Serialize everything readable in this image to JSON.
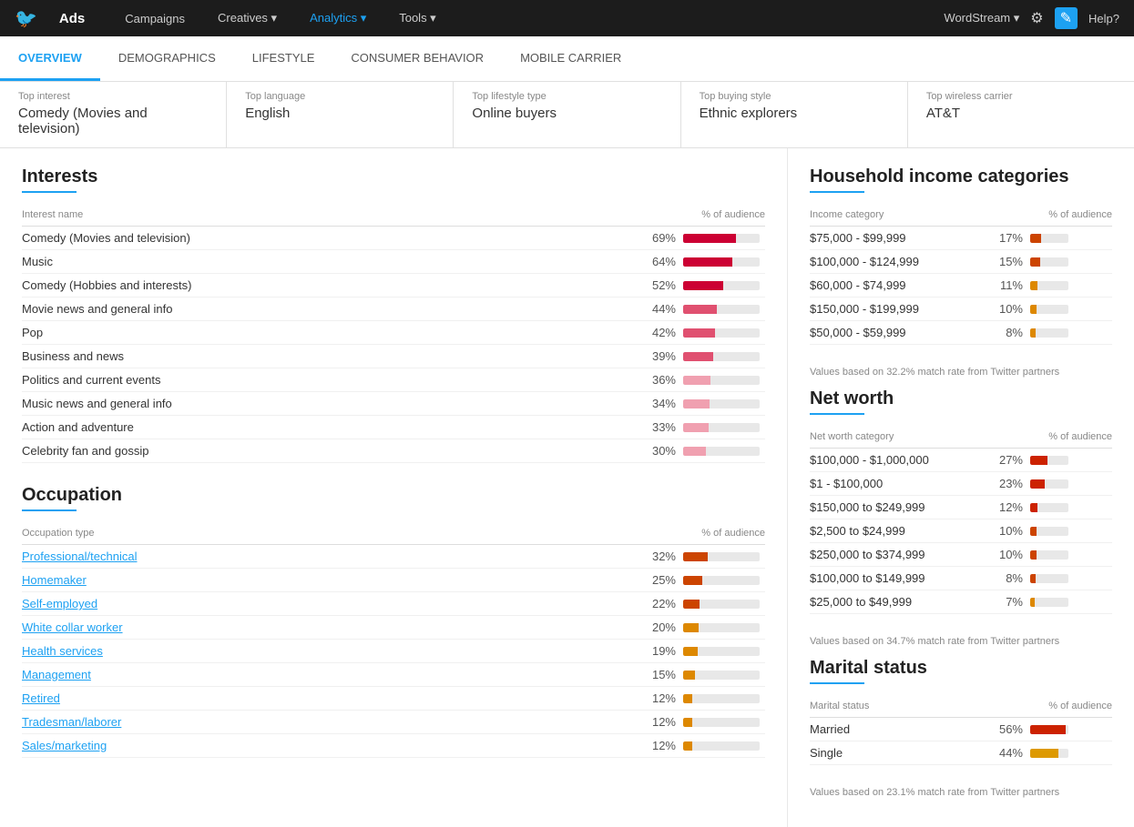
{
  "topnav": {
    "brand": "Ads",
    "items": [
      "Campaigns",
      "Creatives ▾",
      "Analytics ▾",
      "Tools ▾"
    ],
    "active_item": "Analytics ▾",
    "right_items": [
      "WordStream ▾",
      "⚙",
      "✎",
      "Help?"
    ]
  },
  "overview_tabs": [
    "OVERVIEW",
    "DEMOGRAPHICS",
    "LIFESTYLE",
    "CONSUMER BEHAVIOR",
    "MOBILE CARRIER"
  ],
  "active_tab": 0,
  "summary_cards": [
    {
      "label": "Top interest",
      "value": "Comedy (Movies and television)"
    },
    {
      "label": "Top language",
      "value": "English"
    },
    {
      "label": "Top lifestyle type",
      "value": "Online buyers"
    },
    {
      "label": "Top buying style",
      "value": "Ethnic explorers"
    },
    {
      "label": "Top wireless carrier",
      "value": "AT&T"
    }
  ],
  "interests": {
    "title": "Interests",
    "col1": "Interest name",
    "col2": "% of audience",
    "rows": [
      {
        "name": "Comedy (Movies and television)",
        "pct": "69%",
        "val": 69,
        "color": "#cc0033"
      },
      {
        "name": "Music",
        "pct": "64%",
        "val": 64,
        "color": "#cc0033"
      },
      {
        "name": "Comedy (Hobbies and interests)",
        "pct": "52%",
        "val": 52,
        "color": "#cc0033"
      },
      {
        "name": "Movie news and general info",
        "pct": "44%",
        "val": 44,
        "color": "#e05070"
      },
      {
        "name": "Pop",
        "pct": "42%",
        "val": 42,
        "color": "#e05070"
      },
      {
        "name": "Business and news",
        "pct": "39%",
        "val": 39,
        "color": "#e05070"
      },
      {
        "name": "Politics and current events",
        "pct": "36%",
        "val": 36,
        "color": "#f0a0b0"
      },
      {
        "name": "Music news and general info",
        "pct": "34%",
        "val": 34,
        "color": "#f0a0b0"
      },
      {
        "name": "Action and adventure",
        "pct": "33%",
        "val": 33,
        "color": "#f0a0b0"
      },
      {
        "name": "Celebrity fan and gossip",
        "pct": "30%",
        "val": 30,
        "color": "#f0a0b0"
      }
    ]
  },
  "occupation": {
    "title": "Occupation",
    "col1": "Occupation type",
    "col2": "% of audience",
    "rows": [
      {
        "name": "Professional/technical",
        "pct": "32%",
        "val": 32,
        "color": "#cc4400",
        "link": true
      },
      {
        "name": "Homemaker",
        "pct": "25%",
        "val": 25,
        "color": "#cc4400",
        "link": true
      },
      {
        "name": "Self-employed",
        "pct": "22%",
        "val": 22,
        "color": "#cc4400",
        "link": true
      },
      {
        "name": "White collar worker",
        "pct": "20%",
        "val": 20,
        "color": "#dd8800",
        "link": true
      },
      {
        "name": "Health services",
        "pct": "19%",
        "val": 19,
        "color": "#dd8800",
        "link": true
      },
      {
        "name": "Management",
        "pct": "15%",
        "val": 15,
        "color": "#dd8800",
        "link": true
      },
      {
        "name": "Retired",
        "pct": "12%",
        "val": 12,
        "color": "#dd8800",
        "link": true
      },
      {
        "name": "Tradesman/laborer",
        "pct": "12%",
        "val": 12,
        "color": "#dd8800",
        "link": true
      },
      {
        "name": "Sales/marketing",
        "pct": "12%",
        "val": 12,
        "color": "#dd8800",
        "link": true
      }
    ]
  },
  "household_income": {
    "title": "Household income categories",
    "col1": "Income category",
    "col2": "% of audience",
    "note": "Values based on 32.2% match rate from Twitter partners",
    "rows": [
      {
        "name": "$75,000 - $99,999",
        "pct": "17%",
        "val": 17,
        "color": "#cc4400"
      },
      {
        "name": "$100,000 - $124,999",
        "pct": "15%",
        "val": 15,
        "color": "#cc4400"
      },
      {
        "name": "$60,000 - $74,999",
        "pct": "11%",
        "val": 11,
        "color": "#dd8800"
      },
      {
        "name": "$150,000 - $199,999",
        "pct": "10%",
        "val": 10,
        "color": "#dd8800"
      },
      {
        "name": "$50,000 - $59,999",
        "pct": "8%",
        "val": 8,
        "color": "#dd8800"
      }
    ]
  },
  "net_worth": {
    "title": "Net worth",
    "col1": "Net worth category",
    "col2": "% of audience",
    "note": "Values based on 34.7% match rate from Twitter partners",
    "rows": [
      {
        "name": "$100,000 - $1,000,000",
        "pct": "27%",
        "val": 27,
        "color": "#cc2200"
      },
      {
        "name": "$1 - $100,000",
        "pct": "23%",
        "val": 23,
        "color": "#cc2200"
      },
      {
        "name": "$150,000 to $249,999",
        "pct": "12%",
        "val": 12,
        "color": "#cc2200"
      },
      {
        "name": "$2,500 to $24,999",
        "pct": "10%",
        "val": 10,
        "color": "#cc4400"
      },
      {
        "name": "$250,000 to $374,999",
        "pct": "10%",
        "val": 10,
        "color": "#cc4400"
      },
      {
        "name": "$100,000 to $149,999",
        "pct": "8%",
        "val": 8,
        "color": "#cc4400"
      },
      {
        "name": "$25,000 to $49,999",
        "pct": "7%",
        "val": 7,
        "color": "#dd8800"
      }
    ]
  },
  "marital_status": {
    "title": "Marital status",
    "col1": "Marital status",
    "col2": "% of audience",
    "note": "Values based on 23.1% match rate from Twitter partners",
    "rows": [
      {
        "name": "Married",
        "pct": "56%",
        "val": 56,
        "color": "#cc2200"
      },
      {
        "name": "Single",
        "pct": "44%",
        "val": 44,
        "color": "#dd9900"
      }
    ]
  }
}
